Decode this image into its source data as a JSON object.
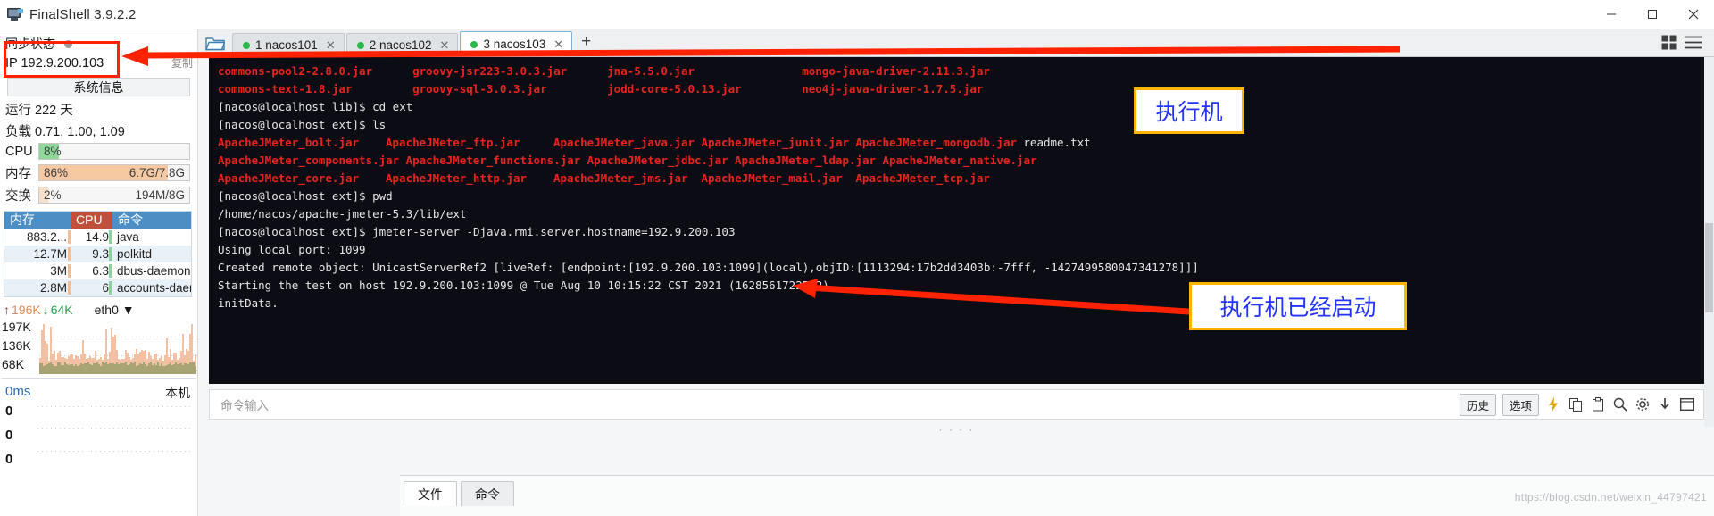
{
  "window": {
    "title": "FinalShell 3.9.2.2",
    "icon": "monitor-icon",
    "minimize": "—",
    "maximize": "▢",
    "close": "✕"
  },
  "sidebar": {
    "sync_label": "同步状态",
    "copy_label": "复制",
    "ip_label": "IP 192.9.200.103",
    "sysinfo_button": "系统信息",
    "uptime": "运行 222 天",
    "load": "负载 0.71, 1.00, 1.09",
    "meters": [
      {
        "label": "CPU",
        "pct": "8%",
        "amount": "",
        "fill_pct": 8,
        "color": "#8fd79a"
      },
      {
        "label": "内存",
        "pct": "86%",
        "amount": "6.7G/7.8G",
        "fill_pct": 86,
        "color": "#f6c9a2"
      },
      {
        "label": "交换",
        "pct": "2%",
        "amount": "194M/8G",
        "fill_pct": 2,
        "color": "#f6e0cc"
      }
    ],
    "process_table": {
      "headers": [
        "内存",
        "CPU",
        "命令"
      ],
      "rows": [
        {
          "mem": "883.2...",
          "cpu": "14.9",
          "cmd": "java"
        },
        {
          "mem": "12.7M",
          "cpu": "9.3",
          "cmd": "polkitd"
        },
        {
          "mem": "3M",
          "cpu": "6.3",
          "cmd": "dbus-daemon"
        },
        {
          "mem": "2.8M",
          "cpu": "6",
          "cmd": "accounts-daemon"
        }
      ]
    },
    "network": {
      "upload": "196K",
      "download": "64K",
      "interface": "eth0",
      "y_labels": [
        "197K",
        "136K",
        "68K"
      ]
    },
    "latency": {
      "value": "0ms",
      "local_label": "本机",
      "y_labels": [
        "0",
        "0",
        "0"
      ]
    }
  },
  "tabs": {
    "folder_icon": "folder-icon",
    "items": [
      {
        "index": "1",
        "label": "1 nacos101",
        "active": false,
        "close": "✕"
      },
      {
        "index": "2",
        "label": "2 nacos102",
        "active": false,
        "close": "✕"
      },
      {
        "index": "3",
        "label": "3 nacos103",
        "active": true,
        "close": "✕"
      }
    ],
    "add": "+",
    "grid_icon": "grid-view-icon",
    "menu_icon": "hamburger-menu-icon"
  },
  "terminal": {
    "lines": [
      {
        "segs": [
          {
            "t": "commons-pool2-2.8.0.jar",
            "c": "red",
            "col": 0
          },
          {
            "t": "groovy-jsr223-3.0.3.jar",
            "c": "red",
            "col": 29
          },
          {
            "t": "jna-5.5.0.jar",
            "c": "red",
            "col": 58
          },
          {
            "t": "mongo-java-driver-2.11.3.jar",
            "c": "red",
            "col": 87
          }
        ]
      },
      {
        "segs": [
          {
            "t": "commons-text-1.8.jar",
            "c": "red",
            "col": 0
          },
          {
            "t": "groovy-sql-3.0.3.jar",
            "c": "red",
            "col": 29
          },
          {
            "t": "jodd-core-5.0.13.jar",
            "c": "red",
            "col": 58
          },
          {
            "t": "neo4j-java-driver-1.7.5.jar",
            "c": "red",
            "col": 87
          }
        ]
      },
      {
        "segs": [
          {
            "t": "[nacos@localhost lib]$ cd ext",
            "c": "w",
            "col": 0
          }
        ]
      },
      {
        "segs": [
          {
            "t": "[nacos@localhost ext]$ ls",
            "c": "w",
            "col": 0
          }
        ]
      },
      {
        "segs": [
          {
            "t": "ApacheJMeter_bolt.jar",
            "c": "red",
            "col": 0
          },
          {
            "t": "ApacheJMeter_ftp.jar",
            "c": "red",
            "col": 25
          },
          {
            "t": "ApacheJMeter_java.jar",
            "c": "red",
            "col": 50
          },
          {
            "t": "ApacheJMeter_junit.jar",
            "c": "red",
            "col": 72
          },
          {
            "t": "ApacheJMeter_mongodb.jar",
            "c": "red",
            "col": 95
          },
          {
            "t": "readme.txt",
            "c": "w",
            "col": 120
          }
        ]
      },
      {
        "segs": [
          {
            "t": "ApacheJMeter_components.jar",
            "c": "red",
            "col": 0
          },
          {
            "t": "ApacheJMeter_functions.jar",
            "c": "red",
            "col": 28
          },
          {
            "t": "ApacheJMeter_jdbc.jar",
            "c": "red",
            "col": 55
          },
          {
            "t": "ApacheJMeter_ldap.jar",
            "c": "red",
            "col": 77
          },
          {
            "t": "ApacheJMeter_native.jar",
            "c": "red",
            "col": 99
          }
        ]
      },
      {
        "segs": [
          {
            "t": "ApacheJMeter_core.jar",
            "c": "red",
            "col": 0
          },
          {
            "t": "ApacheJMeter_http.jar",
            "c": "red",
            "col": 25
          },
          {
            "t": "ApacheJMeter_jms.jar",
            "c": "red",
            "col": 50
          },
          {
            "t": "ApacheJMeter_mail.jar",
            "c": "red",
            "col": 72
          },
          {
            "t": "ApacheJMeter_tcp.jar",
            "c": "red",
            "col": 95
          }
        ]
      },
      {
        "segs": [
          {
            "t": "[nacos@localhost ext]$ pwd",
            "c": "w",
            "col": 0
          }
        ]
      },
      {
        "segs": [
          {
            "t": "/home/nacos/apache-jmeter-5.3/lib/ext",
            "c": "w",
            "col": 0
          }
        ]
      },
      {
        "segs": [
          {
            "t": "[nacos@localhost ext]$ jmeter-server -Djava.rmi.server.hostname=192.9.200.103",
            "c": "w",
            "col": 0
          }
        ]
      },
      {
        "segs": [
          {
            "t": "Using local port: 1099",
            "c": "w",
            "col": 0
          }
        ]
      },
      {
        "segs": [
          {
            "t": "Created remote object: UnicastServerRef2 [liveRef: [endpoint:[192.9.200.103:1099](local),objID:[1113294:17b2dd3403b:-7fff, -1427499580047341278]]]",
            "c": "w",
            "col": 0
          }
        ]
      },
      {
        "segs": [
          {
            "t": "Starting the test on host 192.9.200.103:1099 @ Tue Aug 10 10:15:22 CST 2021 (1628561722562)",
            "c": "w",
            "col": 0
          }
        ]
      },
      {
        "segs": [
          {
            "t": "initData.",
            "c": "w",
            "col": 0
          }
        ]
      }
    ]
  },
  "command_bar": {
    "placeholder": "命令输入",
    "history_button": "历史",
    "options_button": "选项",
    "icons": [
      "lightning-icon",
      "copy-icon",
      "clipboard-icon",
      "search-icon",
      "gear-icon",
      "download-icon",
      "window-icon"
    ]
  },
  "bottom_tabs": [
    {
      "label": "文件",
      "active": true
    },
    {
      "label": "命令",
      "active": false
    }
  ],
  "annotations": [
    {
      "id": "ip-highlight",
      "text": ""
    },
    {
      "id": "executor-box",
      "text": "执行机"
    },
    {
      "id": "executor-started-box",
      "text": "执行机已经启动"
    }
  ],
  "watermark": "https://blog.csdn.net/weixin_44797421",
  "colors": {
    "accent_red": "#ff2200",
    "accent_yellow": "#ffb400",
    "anno_text": "#2233ff",
    "terminal_bg": "#0c0c14",
    "terminal_red": "#e8241f",
    "tab_active": "#ffffff",
    "dot_green": "#2db84a"
  }
}
